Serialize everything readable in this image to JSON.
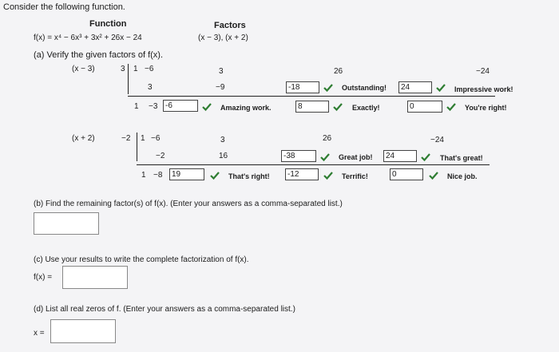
{
  "intro": "Consider the following function.",
  "headers": {
    "function": "Function",
    "factors": "Factors"
  },
  "function_text": "f(x) = x⁴ − 6x³ + 3x² + 26x − 24",
  "factors_text": "(x − 3), (x + 2)",
  "part_a": "(a) Verify the given factors of f(x).",
  "div1": {
    "divisor": "(x − 3)",
    "root": "3",
    "coefs": [
      "1",
      "−6",
      "3",
      "26",
      "−24"
    ],
    "row2": [
      "3",
      "−9"
    ],
    "row3": [
      "1",
      "−3"
    ],
    "inputs": [
      "-6",
      "-18",
      "8",
      "24",
      "0"
    ],
    "feedback": [
      "Amazing work.",
      "Outstanding!",
      "Exactly!",
      "Impressive work!",
      "You're right!"
    ]
  },
  "div2": {
    "divisor": "(x + 2)",
    "root": "−2",
    "coefs": [
      "1",
      "−6",
      "3",
      "26",
      "−24"
    ],
    "row2": [
      "−2",
      "16"
    ],
    "row3": [
      "1",
      "−8"
    ],
    "inputs": [
      "19",
      "-38",
      "-12",
      "24",
      "0"
    ],
    "feedback": [
      "That's right!",
      "Great job!",
      "Terrific!",
      "That's great!",
      "Nice job."
    ]
  },
  "part_b": "(b) Find the remaining factor(s) of f(x). (Enter your answers as a comma-separated list.)",
  "part_c": "(c) Use your results to write the complete factorization of f(x).",
  "part_c_label": "f(x) =",
  "part_d": "(d) List all real zeros of f. (Enter your answers as a comma-separated list.)",
  "part_d_label": "x =",
  "check_color": "#2e7d32"
}
